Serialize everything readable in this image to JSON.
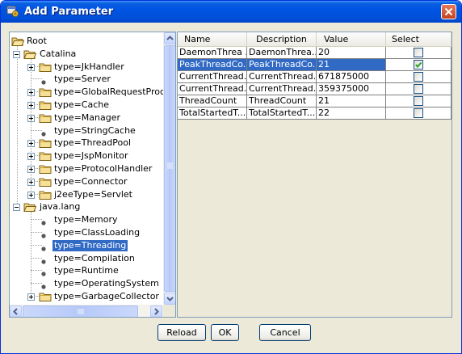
{
  "window": {
    "title": "Add Parameter"
  },
  "tree": {
    "nodes": [
      {
        "label": "Root"
      },
      {
        "label": "Catalina"
      },
      {
        "label": "type=JkHandler"
      },
      {
        "label": "type=Server"
      },
      {
        "label": "type=GlobalRequestProce"
      },
      {
        "label": "type=Cache"
      },
      {
        "label": "type=Manager"
      },
      {
        "label": "type=StringCache"
      },
      {
        "label": "type=ThreadPool"
      },
      {
        "label": "type=JspMonitor"
      },
      {
        "label": "type=ProtocolHandler"
      },
      {
        "label": "type=Connector"
      },
      {
        "label": "j2eeType=Servlet"
      },
      {
        "label": "java.lang"
      },
      {
        "label": "type=Memory"
      },
      {
        "label": "type=ClassLoading"
      },
      {
        "label": "type=Threading"
      },
      {
        "label": "type=Compilation"
      },
      {
        "label": "type=Runtime"
      },
      {
        "label": "type=OperatingSystem"
      },
      {
        "label": "type=GarbageCollector"
      }
    ]
  },
  "table": {
    "columns": [
      "Name",
      "Description",
      "Value",
      "Select"
    ],
    "rows": [
      {
        "name": "DaemonThrea ...",
        "description": "DaemonThrea...",
        "value": "20",
        "selected": false
      },
      {
        "name": "PeakThreadCo...",
        "description": "PeakThreadCo...",
        "value": "21",
        "selected": true
      },
      {
        "name": "CurrentThread...",
        "description": "CurrentThread...",
        "value": "671875000",
        "selected": false
      },
      {
        "name": "CurrentThread...",
        "description": "CurrentThread...",
        "value": "359375000",
        "selected": false
      },
      {
        "name": "ThreadCount",
        "description": "ThreadCount",
        "value": "21",
        "selected": false
      },
      {
        "name": "TotalStartedT...",
        "description": "TotalStartedT...",
        "value": "22",
        "selected": false
      }
    ]
  },
  "buttons": {
    "reload": "Reload",
    "ok": "OK",
    "cancel": "Cancel"
  },
  "colors": {
    "selection": "#316ac5",
    "titlebar": "#0054e3",
    "close": "#d9532c"
  }
}
